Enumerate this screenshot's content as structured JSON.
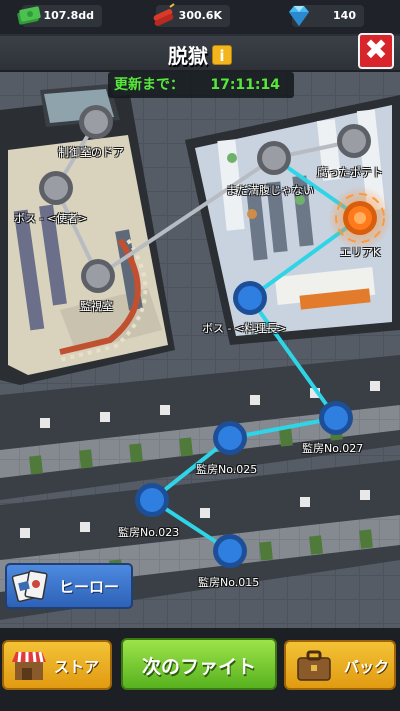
{
  "resources": {
    "cash": "107.8dd",
    "dynamite": "300.6K",
    "gems": "140"
  },
  "header": {
    "title": "脱獄",
    "info_icon": "info-icon",
    "close_icon": "close-icon"
  },
  "timer": {
    "label": "更新まで：",
    "value": "17:11:14"
  },
  "nodes": {
    "control_room_door": "制御室のドア",
    "boss_messenger": "ボス - <使者>",
    "surveillance_room": "監視室",
    "not_full_yet": "まだ満腹じゃない",
    "rotten_potato": "腐ったポテト",
    "area_k": "エリアK",
    "boss_chef": "ボス - <料理長>",
    "cell_027": "監房No.027",
    "cell_025": "監房No.025",
    "cell_023": "監房No.023",
    "cell_015": "監房No.015"
  },
  "buttons": {
    "hero": "ヒーロー",
    "store": "ストア",
    "next_fight": "次のファイト",
    "bag": "バック"
  },
  "colors": {
    "path_active": "#2fd4e6",
    "path_locked": "#b7bcc2",
    "node_active": "#2f7fe0",
    "node_current": "#ff7a1a",
    "node_locked": "#9a9ea4",
    "timer_text": "#57e83a"
  }
}
